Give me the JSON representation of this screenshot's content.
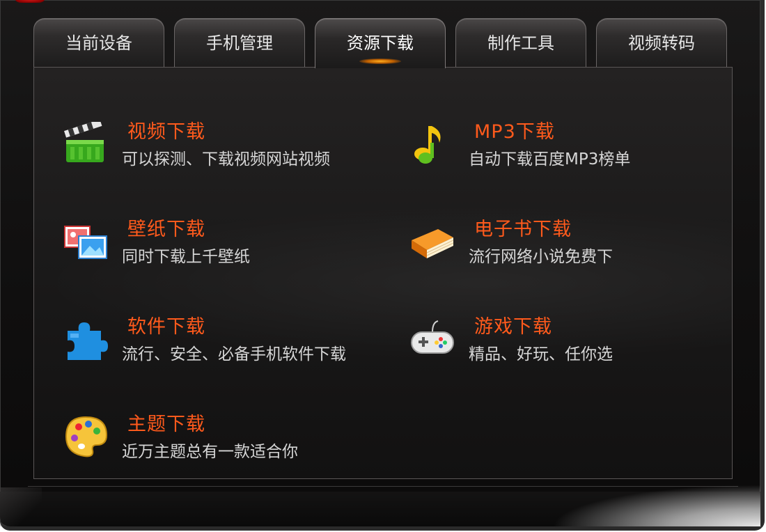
{
  "tabs": [
    {
      "label": "当前设备"
    },
    {
      "label": "手机管理"
    },
    {
      "label": "资源下载"
    },
    {
      "label": "制作工具"
    },
    {
      "label": "视频转码"
    }
  ],
  "active_tab": "资源下载",
  "items": [
    {
      "title": "视频下载",
      "desc": "可以探测、下载视频网站视频",
      "icon": "clapperboard-icon"
    },
    {
      "title": "MP3下载",
      "desc": "自动下载百度MP3榜单",
      "icon": "music-note-icon"
    },
    {
      "title": "壁纸下载",
      "desc": "同时下载上千壁纸",
      "icon": "wallpaper-icon"
    },
    {
      "title": "电子书下载",
      "desc": "流行网络小说免费下",
      "icon": "book-icon"
    },
    {
      "title": "软件下载",
      "desc": "流行、安全、必备手机软件下载",
      "icon": "puzzle-icon"
    },
    {
      "title": "游戏下载",
      "desc": "精品、好玩、任你选",
      "icon": "gamepad-icon"
    },
    {
      "title": "主题下载",
      "desc": "近万主题总有一款适合你",
      "icon": "palette-icon"
    }
  ],
  "colors": {
    "title": "#ff5a1c",
    "desc": "#d6d6d6",
    "tab_glow": "#ffb020"
  }
}
